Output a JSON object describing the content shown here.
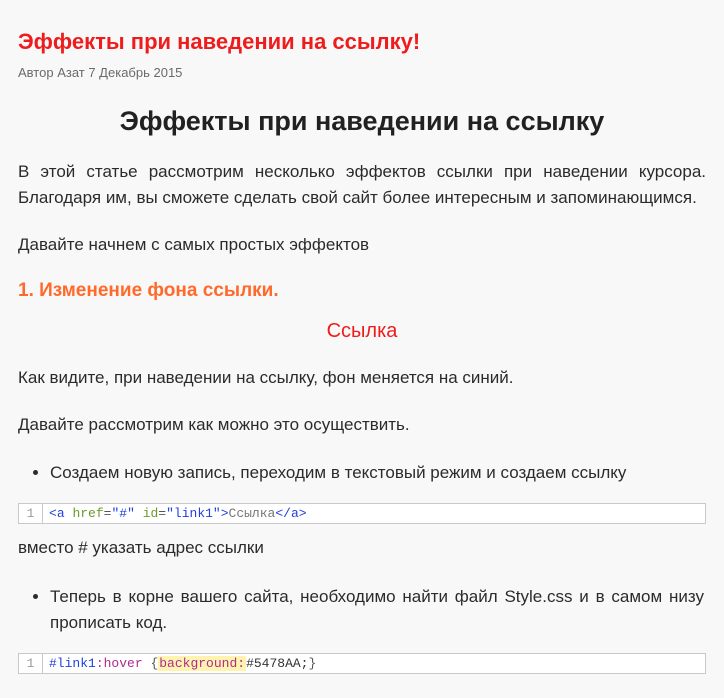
{
  "post": {
    "title": "Эффекты при наведении на ссылку!",
    "author_label": "Автор",
    "author_name": "Азат",
    "pub_date": "7 Декабрь 2015"
  },
  "content": {
    "heading": "Эффекты при наведении на ссылку",
    "intro": "В этой статье рассмотрим несколько эффектов ссылки при наведении курсора. Благодаря им, вы сможете сделать свой сайт более интересным и запоминающимся.",
    "lead": "Давайте начнем с самых простых эффектов",
    "section1_title": "1. Изменение фона ссылки.",
    "demo_link_text": "Ссылка",
    "after_demo": "Как видите, при наведении на ссылку, фон меняется на синий.",
    "how_lead": "Давайте рассмотрим как можно это осуществить.",
    "steps": [
      "Создаем новую запись, переходим в текстовый режим и создаем ссылку",
      "Теперь в корне вашего сайта, необходимо найти файл Style.css и в самом низу прописать код."
    ],
    "note_after_code1": "вместо # указать адрес ссылки"
  },
  "code1": {
    "lineno": "1",
    "parts": {
      "lt1": "<",
      "tag1": "a",
      "sp1": " ",
      "attr1": "href",
      "eq1": "=",
      "val1": "\"#\"",
      "sp2": " ",
      "attr2": "id",
      "eq2": "=",
      "val2": "\"link1\"",
      "gt1": ">",
      "text": "Ссылка",
      "lt2": "</",
      "tag2": "a",
      "gt2": ">"
    }
  },
  "code2": {
    "lineno": "1",
    "parts": {
      "sel": "#link1",
      "pseudo": ":hover",
      "sp": " ",
      "lbrace": "{",
      "prop": "background:",
      "val": "#5478AA;",
      "rbrace": "}"
    }
  }
}
